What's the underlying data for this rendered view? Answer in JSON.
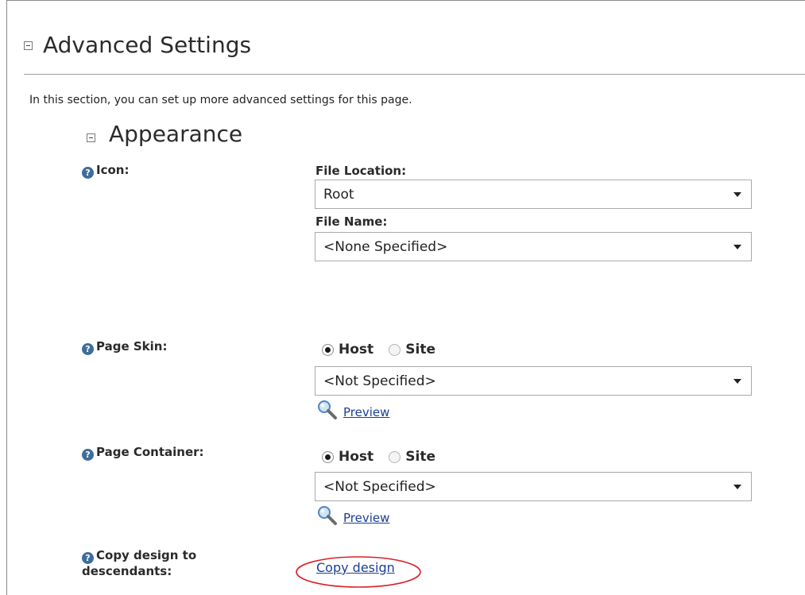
{
  "advanced": {
    "title": "Advanced Settings",
    "intro": "In this section, you can set up more advanced settings for this page."
  },
  "appearance": {
    "title": "Appearance",
    "icon": {
      "label": "Icon:",
      "file_location_label": "File Location:",
      "file_location_value": "Root",
      "file_name_label": "File Name:",
      "file_name_value": "<None Specified>"
    },
    "page_skin": {
      "label": "Page Skin:",
      "options": [
        "Host",
        "Site"
      ],
      "selected": "Host",
      "value": "<Not Specified>",
      "preview": "Preview"
    },
    "page_container": {
      "label": "Page Container:",
      "options": [
        "Host",
        "Site"
      ],
      "selected": "Host",
      "value": "<Not Specified>",
      "preview": "Preview"
    },
    "copy_design": {
      "label_line1": "Copy design to",
      "label_line2": "descendants:",
      "link": "Copy design"
    }
  },
  "icons": {
    "collapse": "minus-box-icon",
    "help": "question-circle-icon",
    "preview": "magnifier-icon",
    "dropdown": "chevron-down-icon"
  },
  "colors": {
    "link": "#1c3f95",
    "help_icon": "#3d6d9b",
    "highlight_circle": "#d9202b"
  }
}
